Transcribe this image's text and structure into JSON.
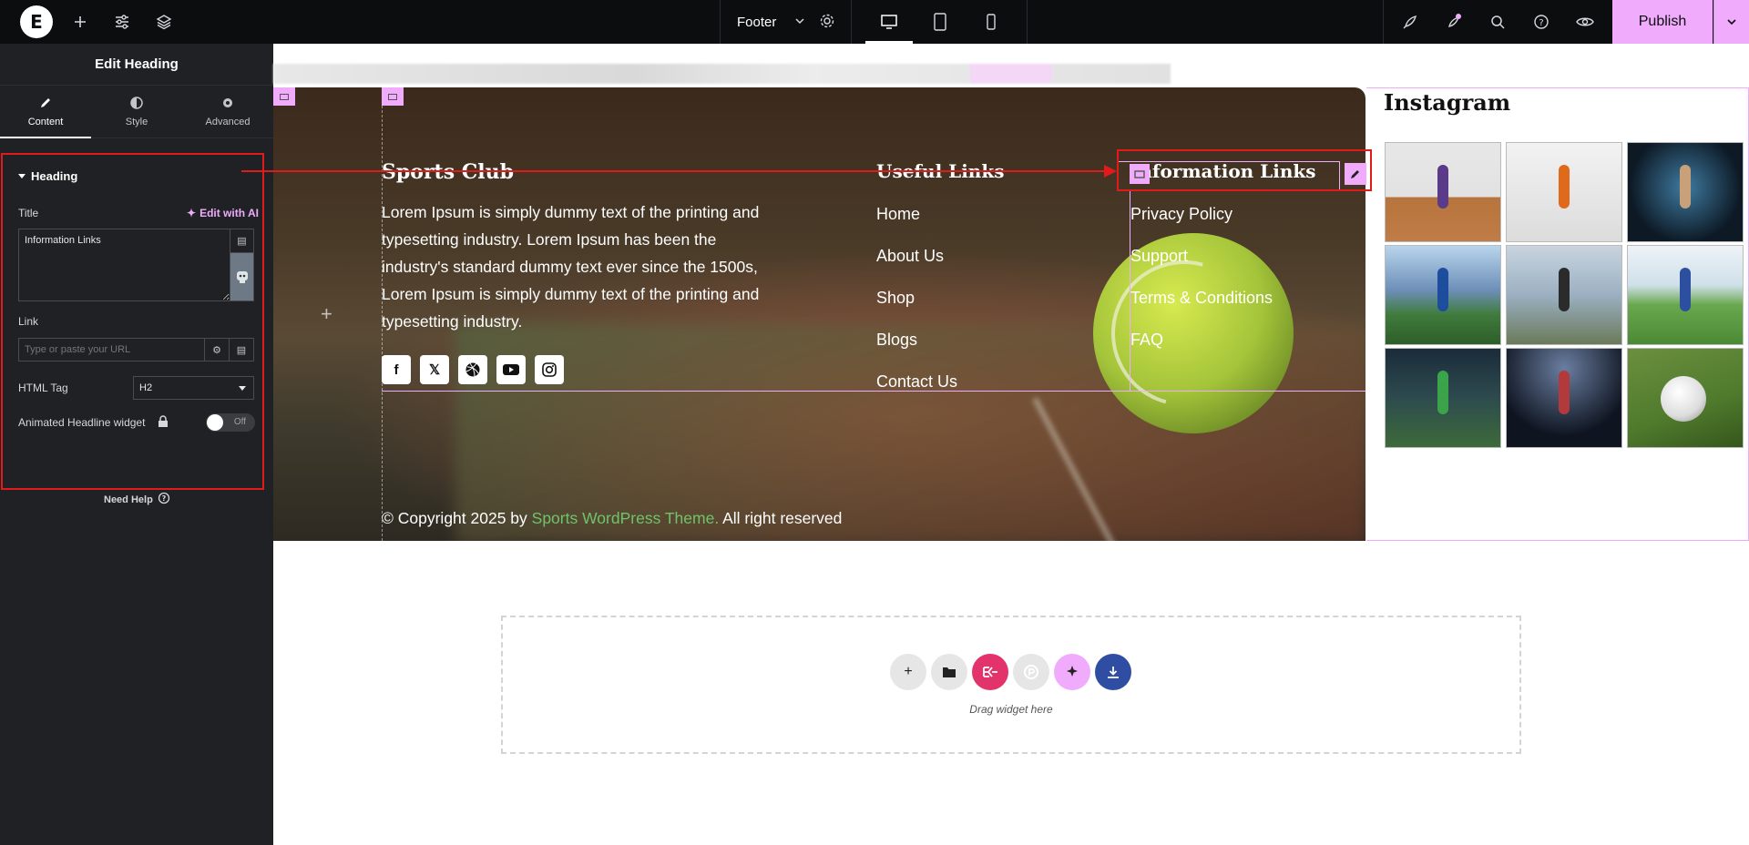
{
  "topbar": {
    "document_name": "Footer",
    "publish_label": "Publish",
    "icons": [
      "elementor-logo-icon",
      "add-icon",
      "settings-sliders-icon",
      "layers-icon",
      "chevron-down-icon",
      "gear-icon",
      "desktop-icon",
      "tablet-icon",
      "mobile-icon",
      "rocket-icon",
      "notifications-icon",
      "search-icon",
      "help-icon",
      "preview-eye-icon"
    ]
  },
  "panel": {
    "title": "Edit Heading",
    "tabs": [
      {
        "label": "Content",
        "active": true
      },
      {
        "label": "Style",
        "active": false
      },
      {
        "label": "Advanced",
        "active": false
      }
    ],
    "section_title": "Heading",
    "title_label": "Title",
    "edit_with_ai": "Edit with AI",
    "title_value": "Information Links",
    "link_label": "Link",
    "link_placeholder": "Type or paste your URL",
    "html_tag_label": "HTML Tag",
    "html_tag_value": "H2",
    "animated_label": "Animated Headline widget",
    "toggle_text": "Off",
    "need_help": "Need Help"
  },
  "footer": {
    "brand_heading": "Sports Club",
    "description": "Lorem Ipsum is simply dummy text of the printing and typesetting industry. Lorem Ipsum has been the industry's standard dummy text ever since the 1500s, Lorem Ipsum is simply dummy text of the printing and typesetting industry.",
    "useful_heading": "Useful Links",
    "useful_links": [
      "Home",
      "About Us",
      "Shop",
      "Blogs",
      "Contact Us"
    ],
    "info_heading": "Information Links",
    "info_links": [
      "Privacy Policy",
      "Support",
      "Terms & Conditions",
      "FAQ"
    ],
    "copyright_prefix": "© Copyright 2025 by ",
    "copyright_link": "Sports WordPress Theme.",
    "copyright_suffix": " All right reserved",
    "socials": [
      "facebook-icon",
      "x-icon",
      "dribbble-icon",
      "youtube-icon",
      "instagram-icon"
    ],
    "instagram_heading": "Instagram"
  },
  "dropzone": {
    "text": "Drag widget here"
  },
  "colors": {
    "accent": "#f0abfc",
    "highlight": "#e11b1b",
    "link_green": "#6fc36b"
  }
}
